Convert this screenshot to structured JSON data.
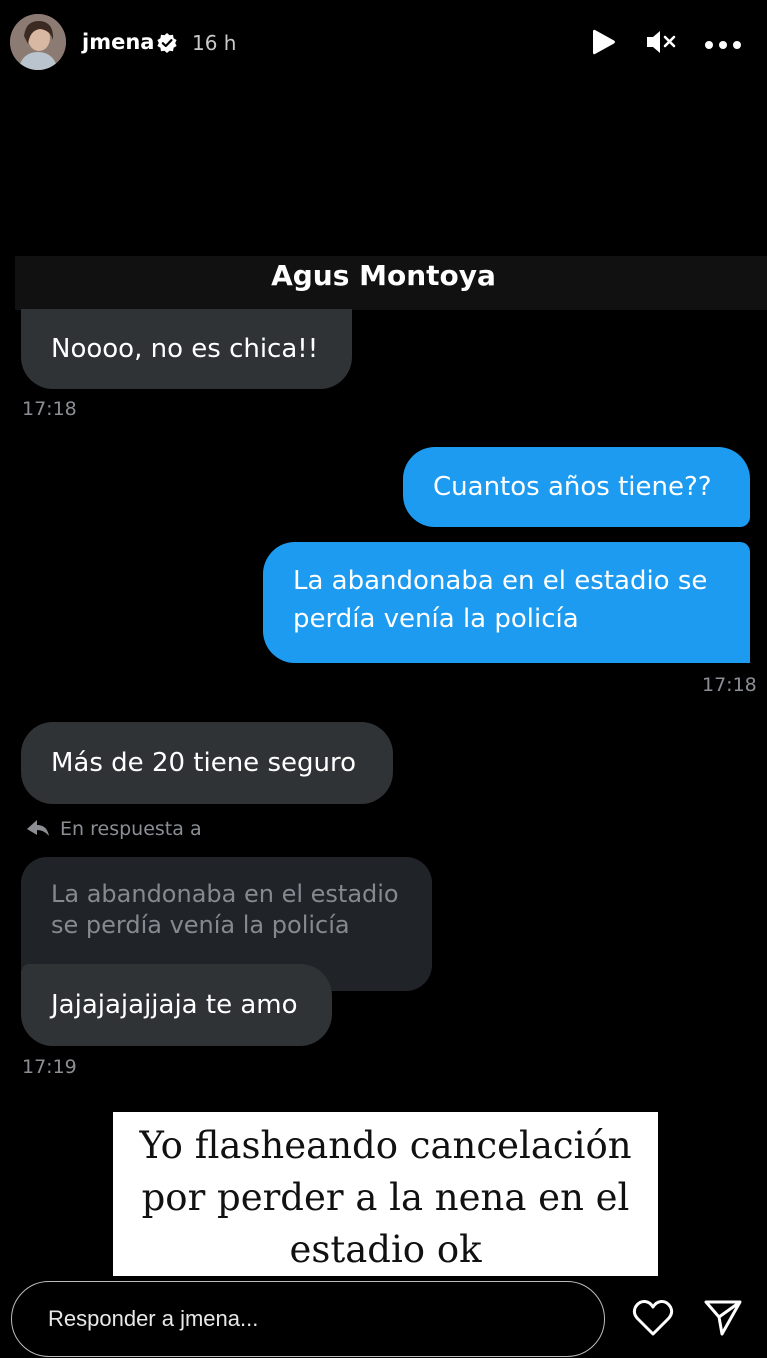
{
  "story": {
    "username": "jmena",
    "time_ago": "16 h",
    "icons": {
      "avatar": "avatar",
      "verified": "verified-badge-icon",
      "play": "play-icon",
      "mute": "mute-icon",
      "more": "more-icon"
    }
  },
  "chat": {
    "contact_name": "Agus Montoya",
    "messages": [
      {
        "direction": "in",
        "text": "Noooo, no es chica!!"
      },
      {
        "direction": "out",
        "text": "Cuantos años tiene??"
      },
      {
        "direction": "out",
        "lines": [
          "La abandonaba en el estadio se",
          "perdía venía la policía"
        ]
      },
      {
        "direction": "in",
        "text": "Más de 20 tiene seguro"
      },
      {
        "direction": "in",
        "text": "Jajajajajjaja te amo"
      }
    ],
    "timestamps": [
      "17:18",
      "17:18",
      "17:19"
    ],
    "reply_label": "En respuesta a",
    "quoted_lines": [
      "La abandonaba en el estadio",
      "se perdía venía la policía"
    ],
    "colors": {
      "incoming_bubble": "#2f3336",
      "outgoing_bubble": "#1d9bf0",
      "quoted_bubble": "#202327"
    }
  },
  "caption": {
    "lines": [
      "Yo flasheando cancelación",
      "por perder a la nena en el",
      "estadio ok"
    ]
  },
  "reply_bar": {
    "placeholder": "Responder a jmena...",
    "icons": {
      "like": "heart-icon",
      "share": "send-icon"
    }
  }
}
